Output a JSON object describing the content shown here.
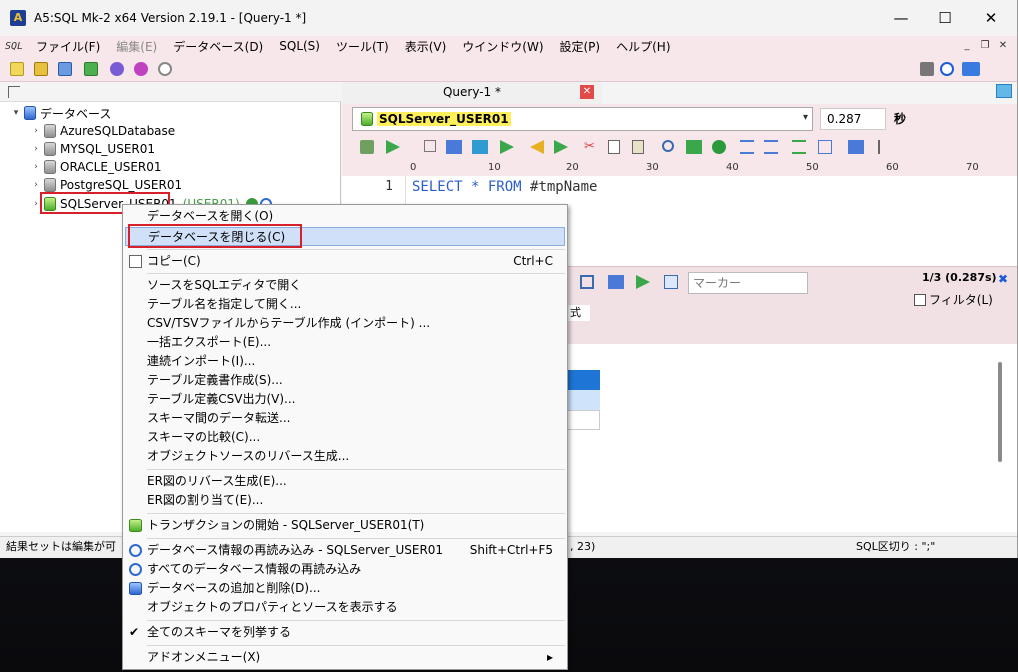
{
  "window": {
    "title": "A5:SQL Mk-2 x64 Version 2.19.1 - [Query-1 *]",
    "app_icon_text": "A",
    "controls": {
      "minimize": "—",
      "maximize": "☐",
      "close": "✕"
    }
  },
  "menubar": {
    "logo": "SQL",
    "items": [
      "ファイル(F)",
      "編集(E)",
      "データベース(D)",
      "SQL(S)",
      "ツール(T)",
      "表示(V)",
      "ウインドウ(W)",
      "設定(P)",
      "ヘルプ(H)"
    ],
    "mdi_controls": {
      "minimize": "_",
      "restore": "❐",
      "close": "✕"
    }
  },
  "tree": {
    "root": "データベース",
    "items": [
      "AzureSQLDatabase",
      "MYSQL_USER01",
      "ORACLE_USER01",
      "PostgreSQL_USER01",
      "SQLServer_USER01"
    ],
    "selected_suffix": "(USER01)"
  },
  "query_tab": {
    "title": "Query-1 *",
    "close": "✕"
  },
  "connection": {
    "name": "SQLServer_USER01",
    "elapsed": "0.287",
    "elapsed_unit": "秒"
  },
  "ruler": {
    "marks": [
      "0",
      "10",
      "20",
      "30",
      "40",
      "50",
      "60",
      "70"
    ]
  },
  "editor": {
    "line_number": "1",
    "keywords": "SELECT * FROM",
    "table": "#tmpName"
  },
  "results": {
    "marker_placeholder": "マーカー",
    "count": "1/3 (0.287s)",
    "filter_label": "フィルタ(L)",
    "clipped_label": "式"
  },
  "status": {
    "left": "結果セットは編集が可",
    "middle": ", 23)",
    "right": "SQL区切り : \";\""
  },
  "context_menu": {
    "items": [
      {
        "label": "データベースを開く(O)",
        "shortcut": ""
      },
      {
        "label": "データベースを閉じる(C)",
        "shortcut": ""
      },
      {
        "label": "コピー(C)",
        "shortcut": "Ctrl+C"
      },
      {
        "label": "ソースをSQLエディタで開く",
        "shortcut": ""
      },
      {
        "label": "テーブル名を指定して開く...",
        "shortcut": ""
      },
      {
        "label": "CSV/TSVファイルからテーブル作成 (インポート) ...",
        "shortcut": ""
      },
      {
        "label": "一括エクスポート(E)...",
        "shortcut": ""
      },
      {
        "label": "連続インポート(I)...",
        "shortcut": ""
      },
      {
        "label": "テーブル定義書作成(S)...",
        "shortcut": ""
      },
      {
        "label": "テーブル定義CSV出力(V)...",
        "shortcut": ""
      },
      {
        "label": "スキーマ間のデータ転送...",
        "shortcut": ""
      },
      {
        "label": "スキーマの比較(C)...",
        "shortcut": ""
      },
      {
        "label": "オブジェクトソースのリバース生成...",
        "shortcut": ""
      },
      {
        "label": "ER図のリバース生成(E)...",
        "shortcut": ""
      },
      {
        "label": "ER図の割り当て(E)...",
        "shortcut": ""
      },
      {
        "label": "トランザクションの開始 - SQLServer_USER01(T)",
        "shortcut": ""
      },
      {
        "label": "データベース情報の再読み込み - SQLServer_USER01",
        "shortcut": "Shift+Ctrl+F5"
      },
      {
        "label": "すべてのデータベース情報の再読み込み",
        "shortcut": ""
      },
      {
        "label": "データベースの追加と削除(D)...",
        "shortcut": ""
      },
      {
        "label": "オブジェクトのプロパティとソースを表示する",
        "shortcut": ""
      },
      {
        "label": "全てのスキーマを列挙する",
        "shortcut": ""
      },
      {
        "label": "アドオンメニュー(X)",
        "shortcut": ""
      }
    ],
    "checkmark": "✔",
    "submenu_arrow": "▸"
  },
  "colors": {
    "accent_pink": "#f7e6ea",
    "highlight_red": "#d7202a",
    "selection_blue": "#1f75d6",
    "connection_yellow": "#ffef5a"
  }
}
